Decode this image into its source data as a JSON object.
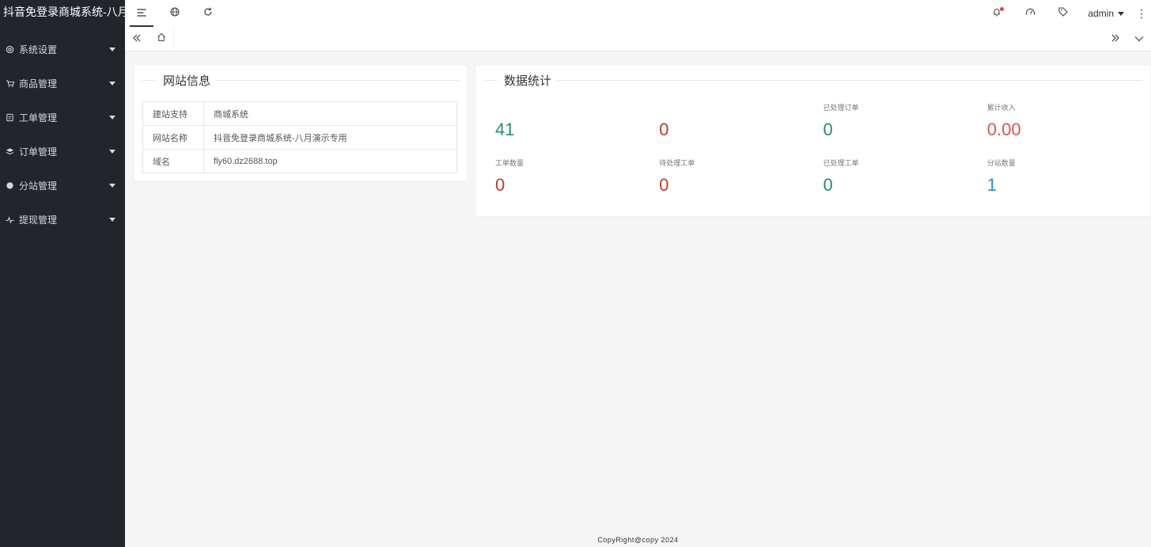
{
  "app": {
    "title": "抖音免登录商城系统-八月"
  },
  "sidebar": {
    "items": [
      {
        "label": "系统设置",
        "icon": "gear-icon"
      },
      {
        "label": "商品管理",
        "icon": "cart-icon"
      },
      {
        "label": "工单管理",
        "icon": "ticket-icon"
      },
      {
        "label": "订单管理",
        "icon": "layers-icon"
      },
      {
        "label": "分站管理",
        "icon": "circle-icon"
      },
      {
        "label": "提现管理",
        "icon": "pulse-icon"
      }
    ]
  },
  "header": {
    "tools": [
      "menu-toggle-icon",
      "globe-icon",
      "refresh-icon"
    ],
    "right_icons": [
      "bell-icon",
      "theme-icon",
      "tag-icon"
    ],
    "user": "admin",
    "more": "⋮"
  },
  "tabbar": {
    "home_icon": "home-icon"
  },
  "site_info": {
    "title": "网站信息",
    "rows": [
      {
        "key": "建站支持",
        "value": "商城系统"
      },
      {
        "key": "网站名称",
        "value": "抖音免登录商城系统-八月演示专用"
      },
      {
        "key": "域名",
        "value": "fly60.dz2688.top"
      }
    ]
  },
  "stats": {
    "title": "数据统计",
    "items": [
      {
        "label": "",
        "value": "41",
        "color": "#2a8a6e"
      },
      {
        "label": "",
        "value": "0",
        "color": "#c0392b"
      },
      {
        "label": "已处理订单",
        "value": "0",
        "color": "#2a8a6e"
      },
      {
        "label": "累计收入",
        "value": "0.00",
        "color": "#d9534f"
      },
      {
        "label": "工单数量",
        "value": "0",
        "color": "#c0392b"
      },
      {
        "label": "待处理工单",
        "value": "0",
        "color": "#c0392b"
      },
      {
        "label": "已处理工单",
        "value": "0",
        "color": "#2a8a6e"
      },
      {
        "label": "分站数量",
        "value": "1",
        "color": "#2a8fbd"
      }
    ]
  },
  "footer": {
    "text": "CopyRight@copy 2024"
  }
}
